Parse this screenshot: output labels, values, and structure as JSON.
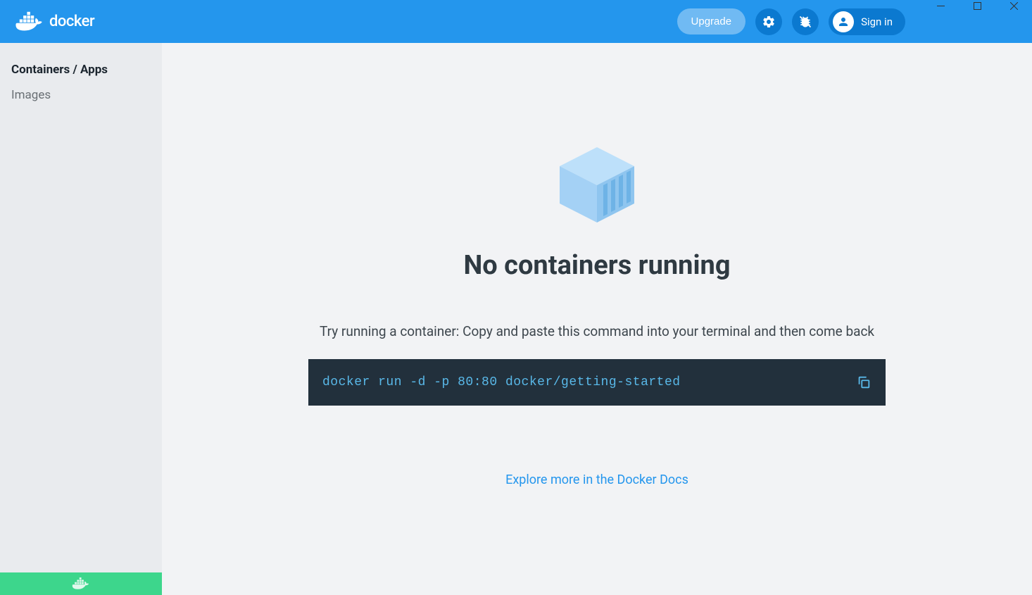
{
  "header": {
    "brand": "docker",
    "upgrade_label": "Upgrade",
    "signin_label": "Sign in"
  },
  "sidebar": {
    "items": [
      {
        "label": "Containers / Apps",
        "active": true
      },
      {
        "label": "Images",
        "active": false
      }
    ]
  },
  "main": {
    "heading": "No containers running",
    "subtext": "Try running a container: Copy and paste this command into your terminal and then come back",
    "command": "docker run -d -p 80:80 docker/getting-started",
    "docs_link": "Explore more in the Docker Docs"
  }
}
